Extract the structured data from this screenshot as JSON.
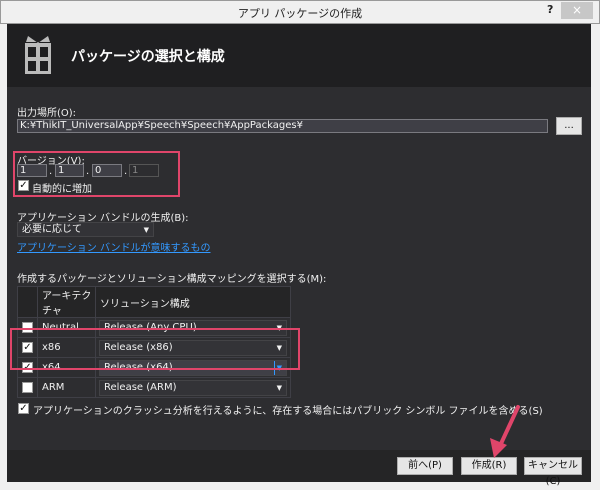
{
  "window": {
    "title": "アプリ パッケージの作成",
    "help": "?",
    "close": "×"
  },
  "header": {
    "title": "パッケージの選択と構成",
    "icon": "package-gift-icon"
  },
  "output": {
    "label": "出力場所(O):",
    "value": "K:¥ThikIT_UniversalApp¥Speech¥Speech¥AppPackages¥",
    "browse": "..."
  },
  "version": {
    "label": "バージョン(V):",
    "parts": [
      "1",
      "1",
      "0",
      "1"
    ],
    "auto_increment": {
      "label": "自動的に増加",
      "checked": true
    }
  },
  "bundle": {
    "label": "アプリケーション バンドルの生成(B):",
    "value": "必要に応じて",
    "link": "アプリケーション バンドルが意味するもの"
  },
  "mapping": {
    "label": "作成するパッケージとソリューション構成マッピングを選択する(M):",
    "columns": [
      "",
      "アーキテクチャ",
      "ソリューション構成"
    ],
    "rows": [
      {
        "arch": "Neutral",
        "config": "Release (Any CPU)",
        "checked": false
      },
      {
        "arch": "x86",
        "config": "Release (x86)",
        "checked": true
      },
      {
        "arch": "x64",
        "config": "Release (x64)",
        "checked": true
      },
      {
        "arch": "ARM",
        "config": "Release (ARM)",
        "checked": false
      }
    ]
  },
  "symbols": {
    "label": "アプリケーションのクラッシュ分析を行えるように、存在する場合にはパブリック シンボル ファイルを含める(S)",
    "checked": true
  },
  "buttons": {
    "prev": "前へ(P)",
    "create": "作成(R)",
    "cancel": "キャンセル(C)"
  },
  "colors": {
    "highlight": "#e0456a",
    "link": "#3399ff"
  }
}
